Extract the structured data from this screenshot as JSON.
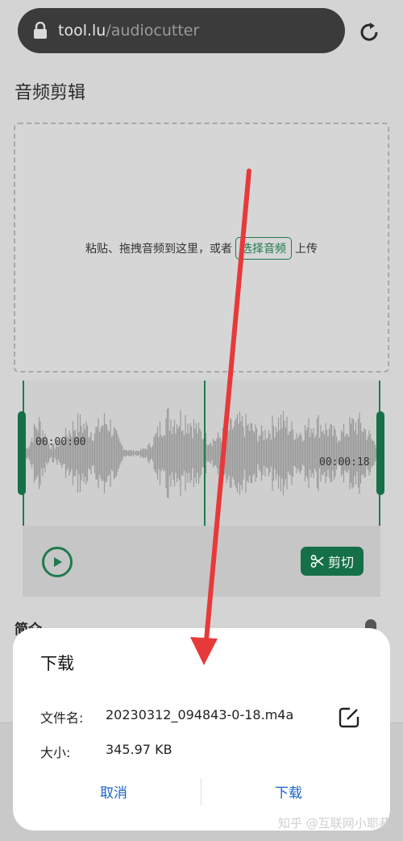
{
  "browser": {
    "url_host": "tool.lu",
    "url_path": "/audiocutter",
    "icons": {
      "lock": "lock-icon",
      "reload": "reload-icon"
    }
  },
  "page": {
    "title": "音频剪辑",
    "drop_zone": {
      "text_before": "粘贴、拖拽音频到这里，或者",
      "choose_button": "选择音频",
      "text_after": "上传"
    },
    "editor": {
      "start_time": "00:00:00",
      "end_time": "00:00:18",
      "play_icon": "play-icon",
      "cut_label": "剪切",
      "cut_icon": "scissors-icon"
    },
    "intro_heading": "简介"
  },
  "dialog": {
    "title": "下载",
    "file_name_label": "文件名:",
    "file_name_value": "20230312_094843-0-18.m4a",
    "size_label": "大小:",
    "size_value": "345.97 KB",
    "edit_icon": "edit-icon",
    "cancel_label": "取消",
    "download_label": "下载"
  },
  "watermark": "知乎 @互联网小耶巷",
  "colors": {
    "accent_green": "#157047",
    "dialog_action_blue": "#1a63c9",
    "annotation_arrow_red": "#e8393a",
    "overlay_dim": "#d4d4d4"
  }
}
